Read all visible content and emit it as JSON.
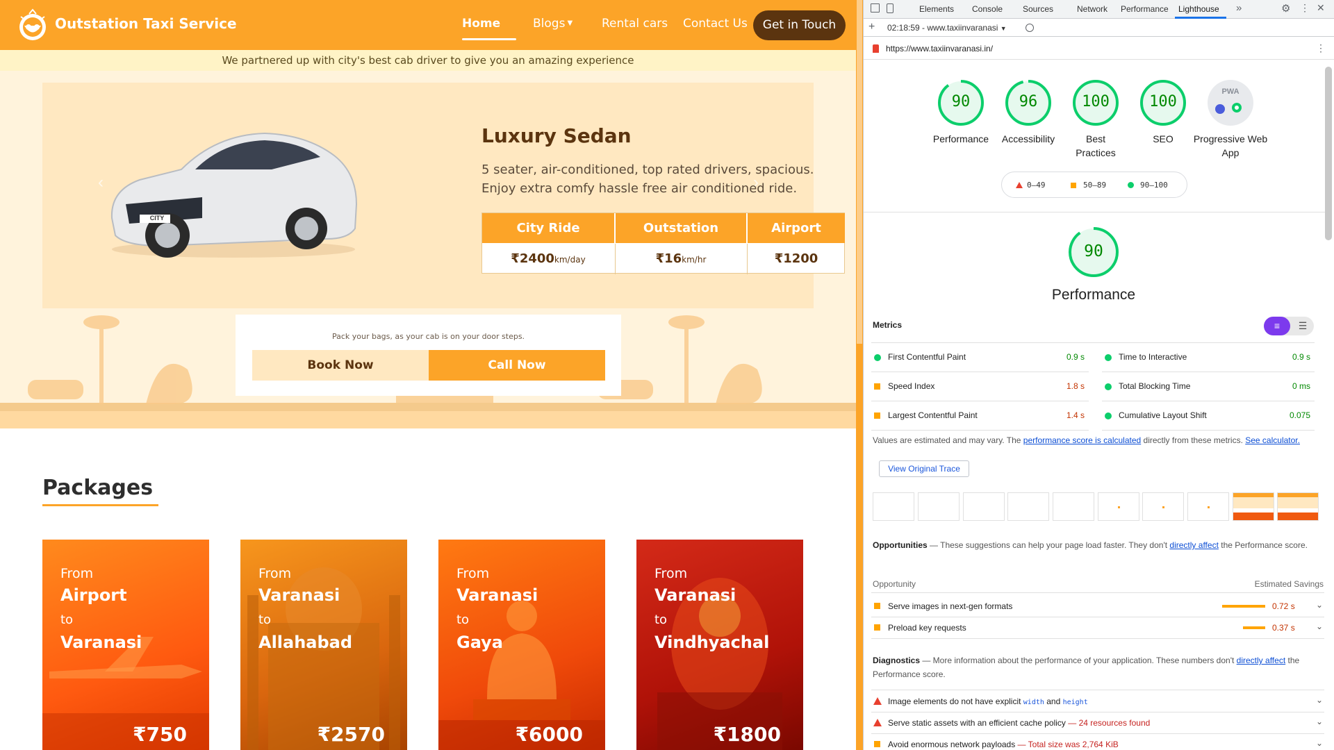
{
  "site": {
    "brand": "Outstation Taxi Service",
    "nav": {
      "home": "Home",
      "blogs": "Blogs",
      "rental": "Rental cars",
      "contact": "Contact Us",
      "get_in_touch": "Get in Touch"
    },
    "tagline": "We partnered up with city's best cab driver to give you an amazing experience",
    "hero": {
      "title": "Luxury Sedan",
      "description": "5 seater, air-conditioned, top rated drivers, spacious. Enjoy extra comfy hassle free air conditioned ride.",
      "car_plate": "CITY",
      "fare_headers": [
        "City Ride",
        "Outstation",
        "Airport"
      ],
      "fares": [
        {
          "amount": "₹2400",
          "unit": "km/day"
        },
        {
          "amount": "₹16",
          "unit": "km/hr"
        },
        {
          "amount": "₹1200",
          "unit": ""
        }
      ],
      "pack_note": "Pack your bags, as your cab is on your door steps.",
      "book_now": "Book Now",
      "call_now": "Call Now"
    },
    "packages_title": "Packages",
    "packages": [
      {
        "from": "From",
        "origin": "Airport",
        "to": "to",
        "dest": "Varanasi",
        "price": "₹750"
      },
      {
        "from": "From",
        "origin": "Varanasi",
        "to": "to",
        "dest": "Allahabad",
        "price": "₹2570"
      },
      {
        "from": "From",
        "origin": "Varanasi",
        "to": "to",
        "dest": "Gaya",
        "price": "₹6000"
      },
      {
        "from": "From",
        "origin": "Varanasi",
        "to": "to",
        "dest": "Vindhyachal",
        "price": "₹1800"
      }
    ],
    "colors": {
      "primary": "#fca428",
      "dark": "#5b340f",
      "tagline_bg": "#fff3c6"
    }
  },
  "devtools": {
    "tabs": [
      "Elements",
      "Console",
      "Sources",
      "Network",
      "Performance",
      "Lighthouse"
    ],
    "active_tab": "Lighthouse",
    "report_select": "02:18:59 - www.taxiinvaranasi",
    "url": "https://www.taxiinvaranasi.in/",
    "scores": [
      {
        "value": "90",
        "label": "Performance"
      },
      {
        "value": "96",
        "label": "Accessibility"
      },
      {
        "value": "100",
        "label": "Best Practices"
      },
      {
        "value": "100",
        "label": "SEO"
      }
    ],
    "pwa_label": "Progressive Web App",
    "pwa_badge": "PWA",
    "legend": [
      "0–49",
      "50–89",
      "90–100"
    ],
    "performance_score": "90",
    "performance_title": "Performance",
    "metrics_title": "Metrics",
    "metrics": [
      {
        "name": "First Contentful Paint",
        "value": "0.9 s",
        "status": "pass"
      },
      {
        "name": "Time to Interactive",
        "value": "0.9 s",
        "status": "pass"
      },
      {
        "name": "Speed Index",
        "value": "1.8 s",
        "status": "average"
      },
      {
        "name": "Total Blocking Time",
        "value": "0 ms",
        "status": "pass"
      },
      {
        "name": "Largest Contentful Paint",
        "value": "1.4 s",
        "status": "average"
      },
      {
        "name": "Cumulative Layout Shift",
        "value": "0.075",
        "status": "pass"
      }
    ],
    "note_prefix": "Values are estimated and may vary. The ",
    "note_link1": "performance score is calculated",
    "note_mid": " directly from these metrics. ",
    "note_link2": "See calculator.",
    "view_trace": "View Original Trace",
    "opportunities_title": "Opportunities",
    "opportunities_desc": " — These suggestions can help your page load faster. They don't ",
    "opportunities_link": "directly affect",
    "opportunities_tail": " the Performance score.",
    "opportunity_col": "Opportunity",
    "savings_col": "Estimated Savings",
    "opportunities": [
      {
        "name": "Serve images in next-gen formats",
        "savings": "0.72 s",
        "bar": 0.72
      },
      {
        "name": "Preload key requests",
        "savings": "0.37 s",
        "bar": 0.37
      }
    ],
    "diagnostics_title": "Diagnostics",
    "diagnostics_desc": " — More information about the performance of your application. These numbers don't ",
    "diagnostics_link": "directly affect",
    "diagnostics_tail": " the Performance score.",
    "diag1_pre": "Image elements do not have explicit ",
    "diag1_code1": "width",
    "diag1_and": " and ",
    "diag1_code2": "height",
    "diag2": "Serve static assets with an efficient cache policy",
    "diag2_detail": " — 24 resources found",
    "diag3": "Avoid enormous network payloads",
    "diag3_detail": " — Total size was 2,764 KiB"
  }
}
